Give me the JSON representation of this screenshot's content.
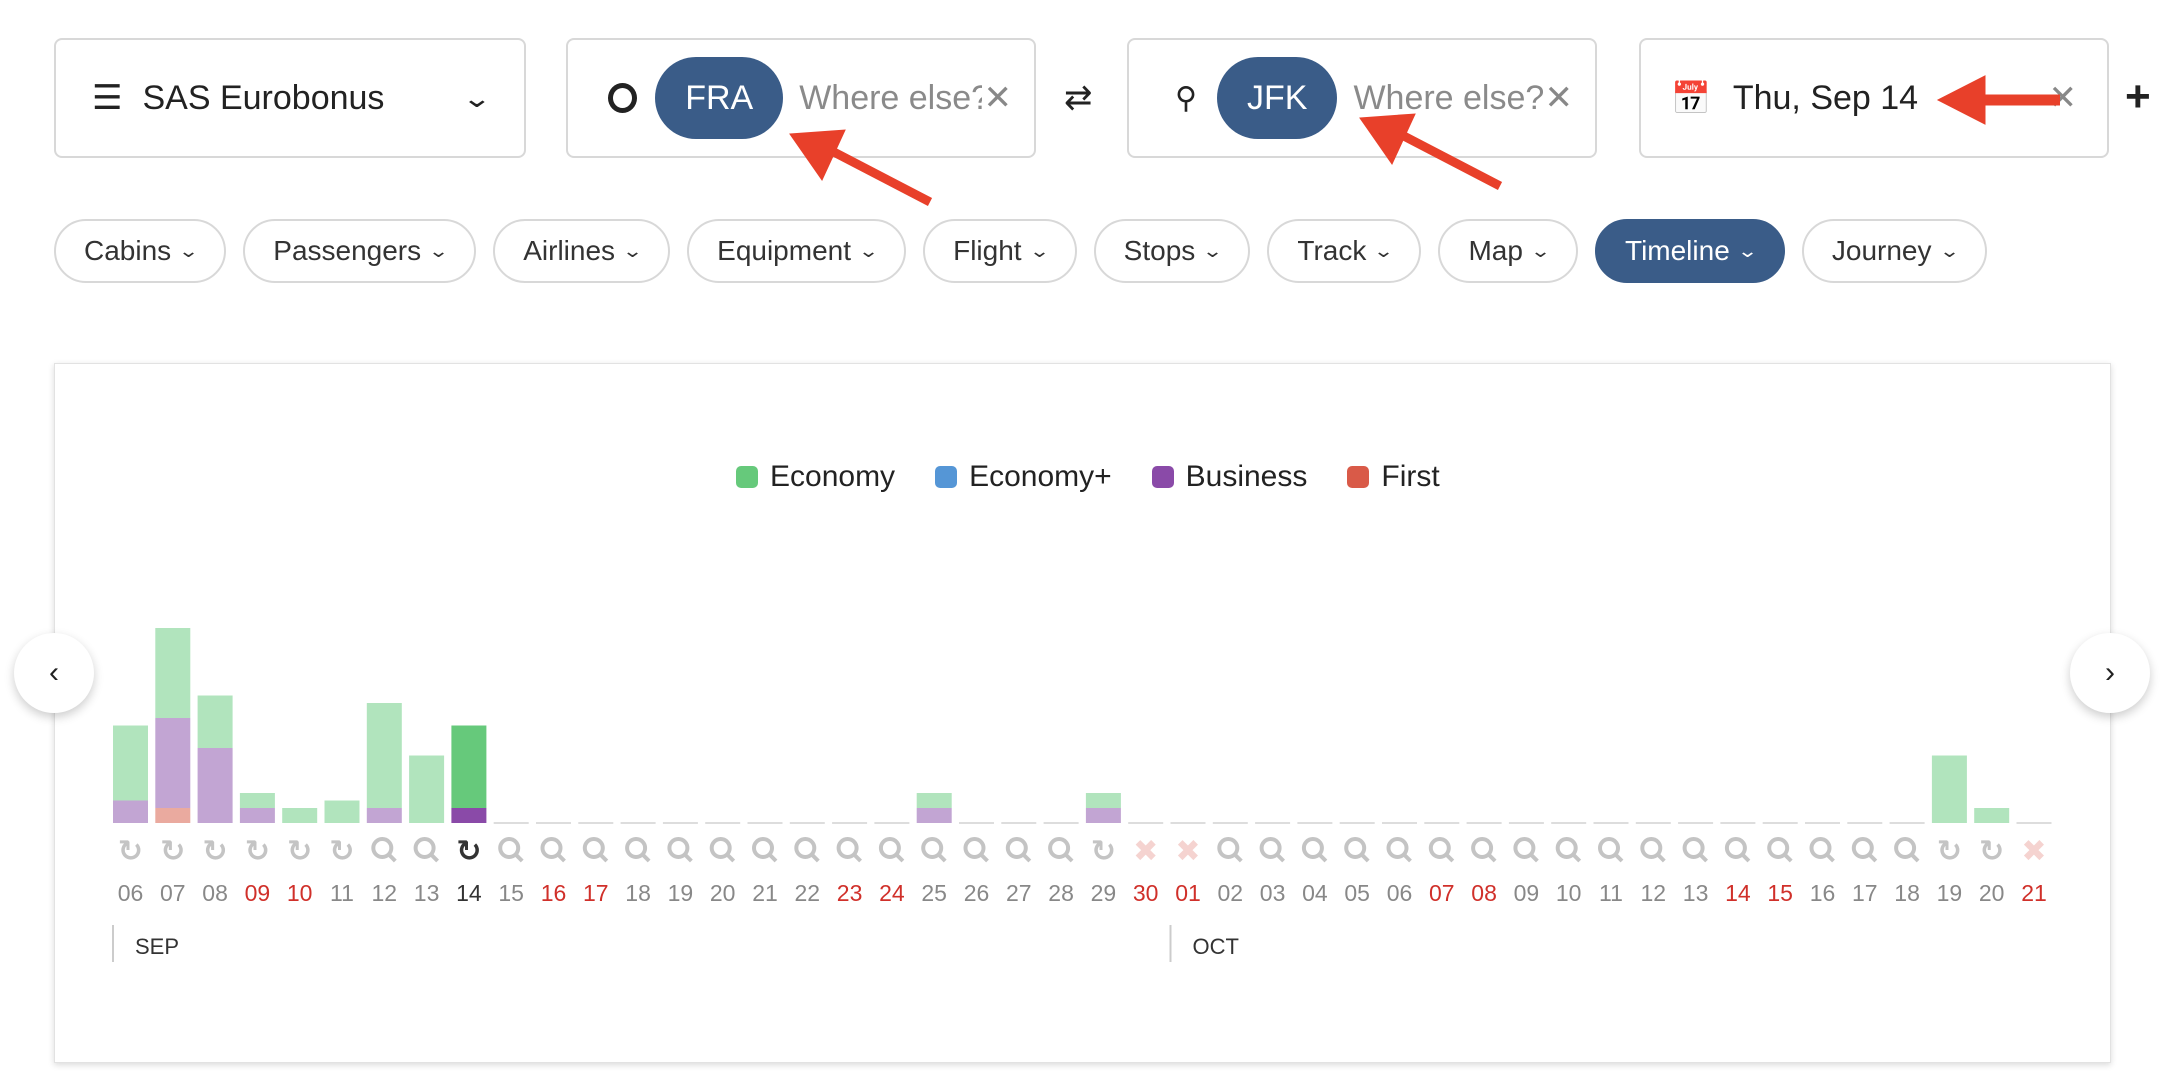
{
  "program_select": {
    "icon": "menu-icon",
    "label": "SAS Eurobonus"
  },
  "origin": {
    "code": "FRA",
    "placeholder": "Where else?",
    "icon": "circle-icon"
  },
  "destination": {
    "code": "JFK",
    "placeholder": "Where else?",
    "icon": "map-pin-icon"
  },
  "date": {
    "label": "Thu, Sep 14",
    "icon": "calendar-icon"
  },
  "filters": [
    {
      "label": "Cabins",
      "active": false
    },
    {
      "label": "Passengers",
      "active": false
    },
    {
      "label": "Airlines",
      "active": false
    },
    {
      "label": "Equipment",
      "active": false
    },
    {
      "label": "Flight",
      "active": false
    },
    {
      "label": "Stops",
      "active": false
    },
    {
      "label": "Track",
      "active": false
    },
    {
      "label": "Map",
      "active": false
    },
    {
      "label": "Timeline",
      "active": true
    },
    {
      "label": "Journey",
      "active": false
    }
  ],
  "colors": {
    "accent": "#3a5c88",
    "weekend": "#d0302a",
    "arrow": "#e8402a"
  },
  "legend": [
    {
      "label": "Economy",
      "color": "#66c97b"
    },
    {
      "label": "Economy+",
      "color": "#5596d6"
    },
    {
      "label": "Business",
      "color": "#8a4aa8"
    },
    {
      "label": "First",
      "color": "#d95a48"
    }
  ],
  "chart_data": {
    "type": "bar",
    "stacked": true,
    "months": [
      {
        "label": "SEP",
        "start_index": 0
      },
      {
        "label": "OCT",
        "start_index": 25
      }
    ],
    "selected_day": "14",
    "categories": [
      "06",
      "07",
      "08",
      "09",
      "10",
      "11",
      "12",
      "13",
      "14",
      "15",
      "16",
      "17",
      "18",
      "19",
      "20",
      "21",
      "22",
      "23",
      "24",
      "25",
      "26",
      "27",
      "28",
      "29",
      "30",
      "01",
      "02",
      "03",
      "04",
      "05",
      "06",
      "07",
      "08",
      "09",
      "10",
      "11",
      "12",
      "13",
      "14",
      "15",
      "16",
      "17",
      "18",
      "19",
      "20",
      "21"
    ],
    "weekend": [
      false,
      false,
      false,
      true,
      true,
      false,
      false,
      false,
      false,
      false,
      true,
      true,
      false,
      false,
      false,
      false,
      false,
      true,
      true,
      false,
      false,
      false,
      false,
      false,
      true,
      true,
      false,
      false,
      false,
      false,
      false,
      true,
      true,
      false,
      false,
      false,
      false,
      false,
      true,
      true,
      false,
      false,
      false,
      false,
      false,
      true
    ],
    "status": [
      "refresh",
      "refresh",
      "refresh",
      "refresh",
      "refresh",
      "refresh",
      "search",
      "search",
      "refresh",
      "search",
      "search",
      "search",
      "search",
      "search",
      "search",
      "search",
      "search",
      "search",
      "search",
      "search",
      "search",
      "search",
      "search",
      "refresh",
      "none",
      "none",
      "search",
      "search",
      "search",
      "search",
      "search",
      "search",
      "search",
      "search",
      "search",
      "search",
      "search",
      "search",
      "search",
      "search",
      "search",
      "search",
      "search",
      "refresh",
      "refresh",
      "none"
    ],
    "series": [
      {
        "name": "Economy",
        "values": [
          10,
          12,
          7,
          2,
          2,
          3,
          14,
          9,
          11,
          0,
          0,
          0,
          0,
          0,
          0,
          0,
          0,
          0,
          0,
          2,
          0,
          0,
          0,
          2,
          0,
          0,
          0,
          0,
          0,
          0,
          0,
          0,
          0,
          0,
          0,
          0,
          0,
          0,
          0,
          0,
          0,
          0,
          0,
          9,
          2,
          0
        ]
      },
      {
        "name": "Economy+",
        "values": [
          0,
          0,
          0,
          0,
          0,
          0,
          0,
          0,
          0,
          0,
          0,
          0,
          0,
          0,
          0,
          0,
          0,
          0,
          0,
          0,
          0,
          0,
          0,
          0,
          0,
          0,
          0,
          0,
          0,
          0,
          0,
          0,
          0,
          0,
          0,
          0,
          0,
          0,
          0,
          0,
          0,
          0,
          0,
          0,
          0,
          0
        ]
      },
      {
        "name": "Business",
        "values": [
          3,
          12,
          10,
          2,
          0,
          0,
          2,
          0,
          2,
          0,
          0,
          0,
          0,
          0,
          0,
          0,
          0,
          0,
          0,
          2,
          0,
          0,
          0,
          2,
          0,
          0,
          0,
          0,
          0,
          0,
          0,
          0,
          0,
          0,
          0,
          0,
          0,
          0,
          0,
          0,
          0,
          0,
          0,
          0,
          0,
          0
        ]
      },
      {
        "name": "First",
        "values": [
          0,
          2,
          0,
          0,
          0,
          0,
          0,
          0,
          0,
          0,
          0,
          0,
          0,
          0,
          0,
          0,
          0,
          0,
          0,
          0,
          0,
          0,
          0,
          0,
          0,
          0,
          0,
          0,
          0,
          0,
          0,
          0,
          0,
          0,
          0,
          0,
          0,
          0,
          0,
          0,
          0,
          0,
          0,
          0,
          0,
          0
        ]
      }
    ],
    "title": "",
    "xlabel": "",
    "ylabel": ""
  }
}
